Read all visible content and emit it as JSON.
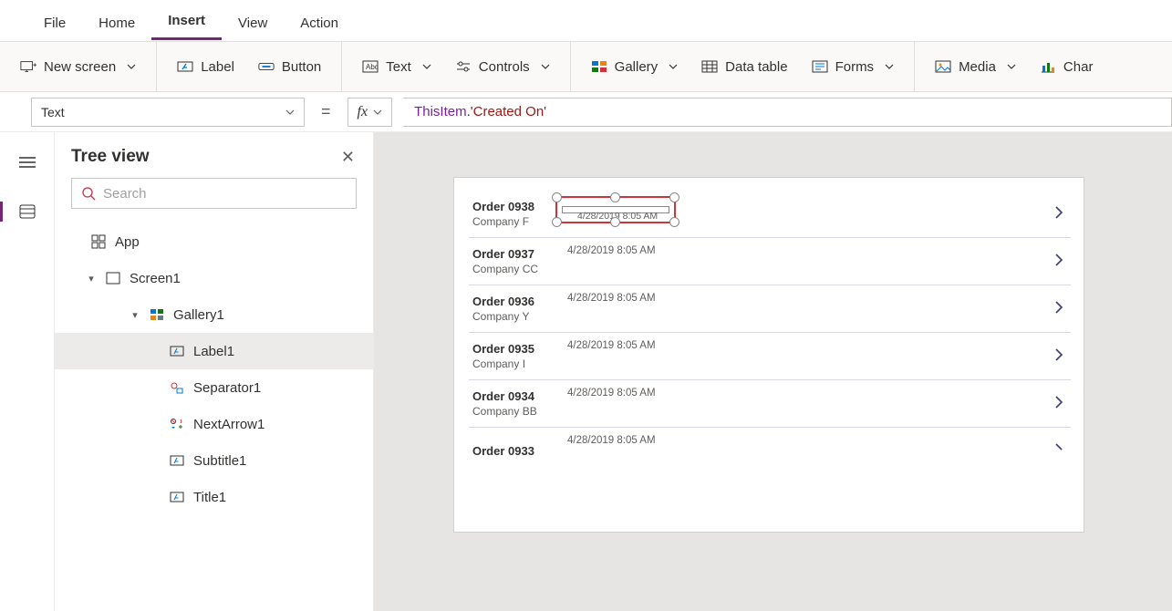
{
  "menu": {
    "tabs": [
      "File",
      "Home",
      "Insert",
      "View",
      "Action"
    ],
    "active": "Insert"
  },
  "ribbon": {
    "new_screen": "New screen",
    "label": "Label",
    "button": "Button",
    "text": "Text",
    "controls": "Controls",
    "gallery": "Gallery",
    "data_table": "Data table",
    "forms": "Forms",
    "media": "Media",
    "charts": "Char"
  },
  "formula": {
    "property": "Text",
    "fx": "fx",
    "expr_obj": "ThisItem",
    "expr_dot": ".",
    "expr_str": "'Created On'"
  },
  "tree": {
    "title": "Tree view",
    "search_placeholder": "Search",
    "app": "App",
    "screen": "Screen1",
    "gallery": "Gallery1",
    "items": [
      "Label1",
      "Separator1",
      "NextArrow1",
      "Subtitle1",
      "Title1"
    ],
    "selected": "Label1"
  },
  "gallery_data": [
    {
      "title": "Order 0938",
      "subtitle": "Company F",
      "date": "4/28/2019 8:05 AM"
    },
    {
      "title": "Order 0937",
      "subtitle": "Company CC",
      "date": "4/28/2019 8:05 AM"
    },
    {
      "title": "Order 0936",
      "subtitle": "Company Y",
      "date": "4/28/2019 8:05 AM"
    },
    {
      "title": "Order 0935",
      "subtitle": "Company I",
      "date": "4/28/2019 8:05 AM"
    },
    {
      "title": "Order 0934",
      "subtitle": "Company BB",
      "date": "4/28/2019 8:05 AM"
    },
    {
      "title": "Order 0933",
      "subtitle": "",
      "date": "4/28/2019 8:05 AM"
    }
  ],
  "selected_date_display": "4/28/2019 8:05 AM"
}
